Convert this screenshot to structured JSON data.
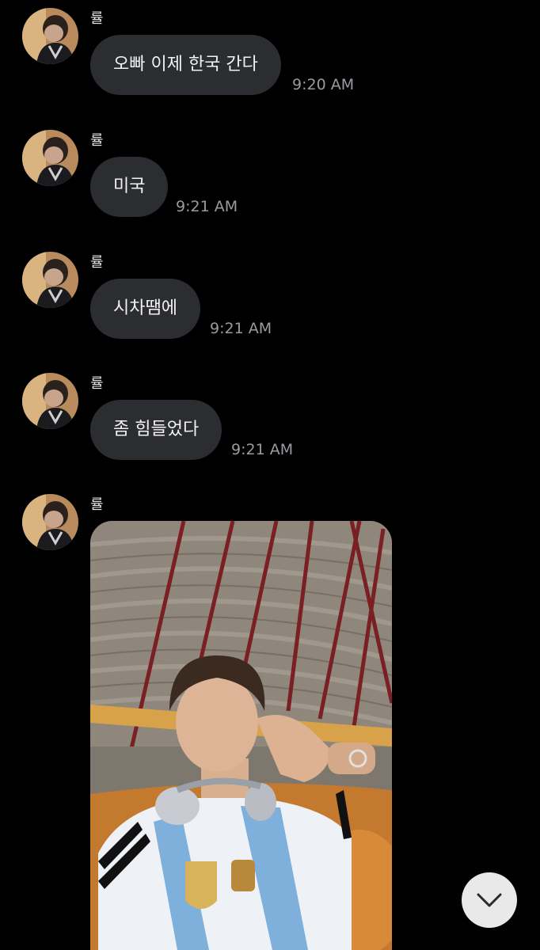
{
  "messages": [
    {
      "sender": "률",
      "text": "오빠 이제 한국 간다",
      "time": "9:20 AM"
    },
    {
      "sender": "률",
      "text": "미국",
      "time": "9:21 AM"
    },
    {
      "sender": "률",
      "text": "시차땜에",
      "time": "9:21 AM"
    },
    {
      "sender": "률",
      "text": "좀 힘들었다",
      "time": "9:21 AM"
    }
  ],
  "photo_message": {
    "sender": "률",
    "type": "image"
  },
  "colors": {
    "background": "#000000",
    "bubble": "#2c2d31",
    "time_text": "#9a9ba0",
    "scroll_button": "#e9e9ea"
  },
  "icons": {
    "scroll_down": "chevron-down-icon",
    "avatar": "profile-photo"
  }
}
